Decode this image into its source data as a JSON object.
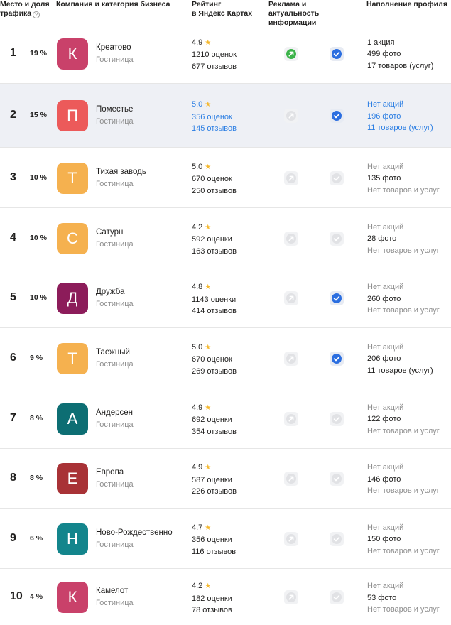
{
  "header": {
    "col_place_line1": "Место и доля",
    "col_place_line2": "трафика",
    "col_company": "Компания и категория бизнеса",
    "col_rating_line1": "Рейтинг",
    "col_rating_line2": "в Яндекс Картах",
    "col_ads_line1": "Реклама и актуальность",
    "col_ads_line2": "информации",
    "col_profile": "Наполнение профиля",
    "help_glyph": "?"
  },
  "colors": {
    "accent_blue": "#2b7ee3",
    "highlight_row": "#eef0f5",
    "star": "#f5b82e"
  },
  "rows": [
    {
      "rank": "1",
      "share": "19 %",
      "letter": "К",
      "avatar_color": "#c9416a",
      "name": "Креатово",
      "category": "Гостиница",
      "rating": "4.9",
      "ratings_count": "1210 оценок",
      "reviews_count": "677 отзывов",
      "ad_active": true,
      "info_verified": true,
      "promo": "1 акция",
      "photos": "499 фото",
      "goods": "17 товаров (услуг)",
      "highlighted": false
    },
    {
      "rank": "2",
      "share": "15 %",
      "letter": "П",
      "avatar_color": "#ec5a5a",
      "name": "Поместье",
      "category": "Гостиница",
      "rating": "5.0",
      "ratings_count": "356 оценок",
      "reviews_count": "145 отзывов",
      "ad_active": false,
      "info_verified": true,
      "promo": "Нет акций",
      "photos": "196 фото",
      "goods": "11 товаров (услуг)",
      "highlighted": true
    },
    {
      "rank": "3",
      "share": "10 %",
      "letter": "Т",
      "avatar_color": "#f5b14f",
      "name": "Тихая заводь",
      "category": "Гостиница",
      "rating": "5.0",
      "ratings_count": "670 оценок",
      "reviews_count": "250 отзывов",
      "ad_active": false,
      "info_verified": false,
      "promo": "Нет акций",
      "photos": "135 фото",
      "goods": "Нет товаров и услуг",
      "highlighted": false
    },
    {
      "rank": "4",
      "share": "10 %",
      "letter": "С",
      "avatar_color": "#f5b14f",
      "name": "Сатурн",
      "category": "Гостиница",
      "rating": "4.2",
      "ratings_count": "592 оценки",
      "reviews_count": "163 отзывов",
      "ad_active": false,
      "info_verified": false,
      "promo": "Нет акций",
      "photos": "28 фото",
      "goods": "Нет товаров и услуг",
      "highlighted": false
    },
    {
      "rank": "5",
      "share": "10 %",
      "letter": "Д",
      "avatar_color": "#8c1c5a",
      "name": "Дружба",
      "category": "Гостиница",
      "rating": "4.8",
      "ratings_count": "1143 оценки",
      "reviews_count": "414 отзывов",
      "ad_active": false,
      "info_verified": true,
      "promo": "Нет акций",
      "photos": "260 фото",
      "goods": "Нет товаров и услуг",
      "highlighted": false
    },
    {
      "rank": "6",
      "share": "9 %",
      "letter": "Т",
      "avatar_color": "#f5b14f",
      "name": "Таежный",
      "category": "Гостиница",
      "rating": "5.0",
      "ratings_count": "670 оценок",
      "reviews_count": "269 отзывов",
      "ad_active": false,
      "info_verified": true,
      "promo": "Нет акций",
      "photos": "206 фото",
      "goods": "11 товаров (услуг)",
      "highlighted": false
    },
    {
      "rank": "7",
      "share": "8 %",
      "letter": "А",
      "avatar_color": "#0d6e73",
      "name": "Андерсен",
      "category": "Гостиница",
      "rating": "4.9",
      "ratings_count": "692 оценки",
      "reviews_count": "354 отзывов",
      "ad_active": false,
      "info_verified": false,
      "promo": "Нет акций",
      "photos": "122 фото",
      "goods": "Нет товаров и услуг",
      "highlighted": false
    },
    {
      "rank": "8",
      "share": "8 %",
      "letter": "Е",
      "avatar_color": "#a83236",
      "name": "Европа",
      "category": "Гостиница",
      "rating": "4.9",
      "ratings_count": "587 оценки",
      "reviews_count": "226 отзывов",
      "ad_active": false,
      "info_verified": false,
      "promo": "Нет акций",
      "photos": "146 фото",
      "goods": "Нет товаров и услуг",
      "highlighted": false
    },
    {
      "rank": "9",
      "share": "6 %",
      "letter": "Н",
      "avatar_color": "#13858c",
      "name": "Ново-Рождественно",
      "category": "Гостиница",
      "rating": "4.7",
      "ratings_count": "356 оценки",
      "reviews_count": "116 отзывов",
      "ad_active": false,
      "info_verified": false,
      "promo": "Нет акций",
      "photos": "150 фото",
      "goods": "Нет товаров и услуг",
      "highlighted": false
    },
    {
      "rank": "10",
      "share": "4 %",
      "letter": "К",
      "avatar_color": "#c9416a",
      "name": "Камелот",
      "category": "Гостиница",
      "rating": "4.2",
      "ratings_count": "182 оценки",
      "reviews_count": "78 отзывов",
      "ad_active": false,
      "info_verified": false,
      "promo": "Нет акций",
      "photos": "53 фото",
      "goods": "Нет товаров и услуг",
      "highlighted": false
    }
  ]
}
